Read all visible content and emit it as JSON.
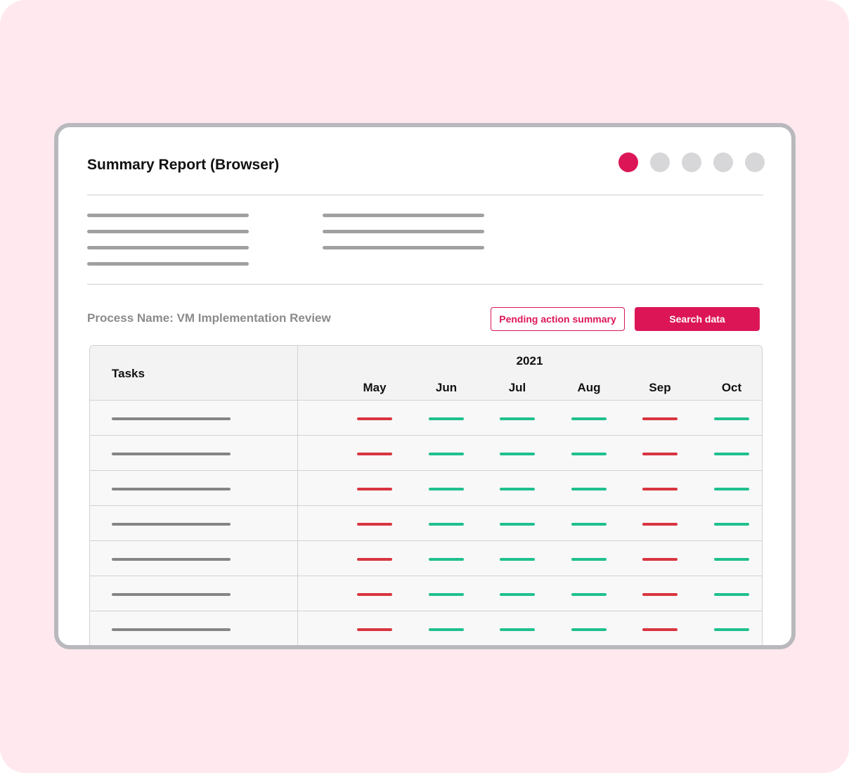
{
  "window": {
    "title": "Summary Report (Browser)",
    "step_dots": [
      {
        "name": "step-dot-1",
        "active": true
      },
      {
        "name": "step-dot-2",
        "active": false
      },
      {
        "name": "step-dot-3",
        "active": false
      },
      {
        "name": "step-dot-4",
        "active": false
      },
      {
        "name": "step-dot-5",
        "active": false
      }
    ]
  },
  "process": {
    "label": "Process Name: VM Implementation Review"
  },
  "actions": {
    "pending_label": "Pending action summary",
    "search_label": "Search data"
  },
  "table": {
    "tasks_header": "Tasks",
    "year": "2021",
    "months": [
      "May",
      "Jun",
      "Jul",
      "Aug",
      "Sep",
      "Oct"
    ],
    "rows": [
      [
        "bad",
        "good",
        "good",
        "good",
        "bad",
        "good"
      ],
      [
        "bad",
        "good",
        "good",
        "good",
        "bad",
        "good"
      ],
      [
        "bad",
        "good",
        "good",
        "good",
        "bad",
        "good"
      ],
      [
        "bad",
        "good",
        "good",
        "good",
        "bad",
        "good"
      ],
      [
        "bad",
        "good",
        "good",
        "good",
        "bad",
        "good"
      ],
      [
        "bad",
        "good",
        "good",
        "good",
        "bad",
        "good"
      ],
      [
        "bad",
        "good",
        "good",
        "good",
        "bad",
        "good"
      ]
    ]
  },
  "colors": {
    "accent": "#dc1656",
    "good": "#1fc08e",
    "bad": "#d93540"
  }
}
